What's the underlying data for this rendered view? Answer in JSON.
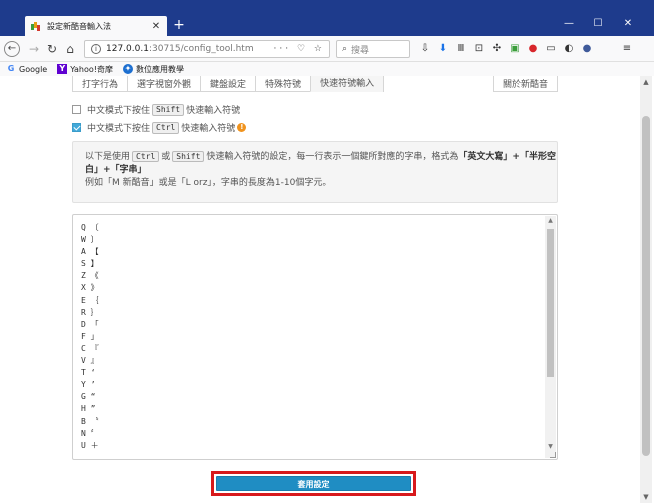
{
  "browser": {
    "tab_title": "設定新酷音輸入法",
    "tab_close": "✕",
    "new_tab": "+",
    "window_controls": {
      "minimize": "—",
      "maximize": "☐",
      "close": "✕"
    },
    "url_host": "127.0.0.1",
    "url_path": ":30715/config_tool.htm",
    "url_actions": "··· ♡ ☆",
    "search_placeholder": "搜尋",
    "bookmarks": [
      {
        "label": "Google",
        "icon": "G"
      },
      {
        "label": "Yahoo!奇摩",
        "icon": "Y"
      },
      {
        "label": "數位應用教學",
        "icon": "✦"
      }
    ]
  },
  "tabs": [
    {
      "label": "打字行為"
    },
    {
      "label": "選字視窗外觀"
    },
    {
      "label": "鍵盤設定"
    },
    {
      "label": "特殊符號"
    },
    {
      "label": "快速符號輸入"
    },
    {
      "label": ""
    },
    {
      "label": "關於新酷音"
    }
  ],
  "options": {
    "shift": {
      "before": "中文模式下按住",
      "key": "Shift",
      "after": "快速輸入符號",
      "checked": false
    },
    "ctrl": {
      "before": "中文模式下按住",
      "key": "Ctrl",
      "after": "快速輸入符號",
      "checked": true,
      "warning": "!"
    }
  },
  "info": {
    "p1": "以下是使用",
    "key_ctrl": "Ctrl",
    "p2": "或",
    "key_shift": "Shift",
    "p3": "快速輸入符號的設定，每一行表示一個鍵所對應的字串，格式為",
    "bold1": "「英文大寫」+「半形空",
    "bold2": "白」+「字串」",
    "line3": "例如「M 新酷音」或是「L orz」，字串的長度為1-10個字元。"
  },
  "editor": {
    "lines": [
      "Q 〔",
      "W 〕",
      "A 【",
      "S 】",
      "Z 《",
      "X 》",
      "E ｛",
      "R ｝",
      "D 「",
      "F 」",
      "C 『",
      "V 』",
      "T ‘",
      "Y ’",
      "G “",
      "H ”",
      "B 〝",
      "N 〞",
      "U ＋"
    ]
  },
  "apply_button": "套用設定",
  "colors": {
    "accent": "#1f8dc3",
    "highlight_border": "#d7191c",
    "titlebar": "#1e3b8c",
    "checkbox": "#43a9d9",
    "warning": "#f0931e"
  }
}
